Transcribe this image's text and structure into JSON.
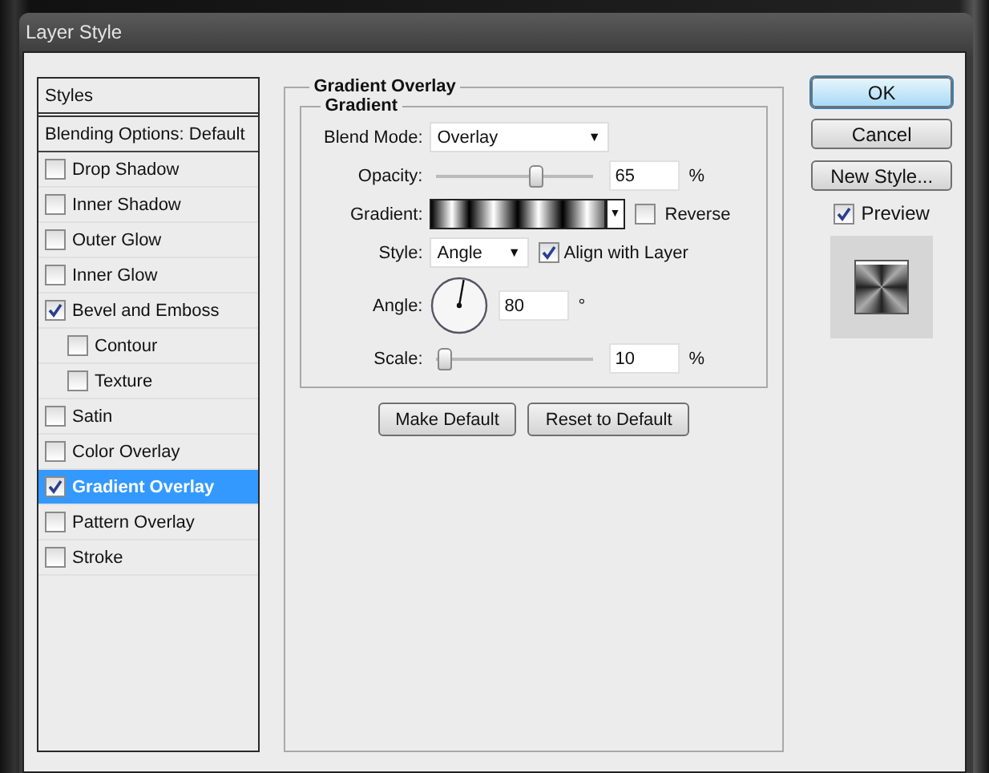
{
  "window": {
    "title": "Layer Style"
  },
  "styles_list": [
    {
      "label": "Styles",
      "kind": "header",
      "selected": false
    },
    {
      "label": "Blending Options: Default",
      "kind": "option",
      "selected": false
    },
    {
      "label": "Drop Shadow",
      "kind": "effect",
      "checked": false,
      "selected": false
    },
    {
      "label": "Inner Shadow",
      "kind": "effect",
      "checked": false,
      "selected": false
    },
    {
      "label": "Outer Glow",
      "kind": "effect",
      "checked": false,
      "selected": false
    },
    {
      "label": "Inner Glow",
      "kind": "effect",
      "checked": false,
      "selected": false
    },
    {
      "label": "Bevel and Emboss",
      "kind": "effect",
      "checked": true,
      "selected": false,
      "children": [
        {
          "label": "Contour",
          "kind": "effect",
          "checked": false,
          "selected": false
        },
        {
          "label": "Texture",
          "kind": "effect",
          "checked": false,
          "selected": false
        }
      ]
    },
    {
      "label": "Satin",
      "kind": "effect",
      "checked": false,
      "selected": false
    },
    {
      "label": "Color Overlay",
      "kind": "effect",
      "checked": false,
      "selected": false
    },
    {
      "label": "Gradient Overlay",
      "kind": "effect",
      "checked": true,
      "selected": true
    },
    {
      "label": "Pattern Overlay",
      "kind": "effect",
      "checked": false,
      "selected": false
    },
    {
      "label": "Stroke",
      "kind": "effect",
      "checked": false,
      "selected": false
    }
  ],
  "panel": {
    "title": "Gradient Overlay",
    "group_title": "Gradient",
    "blend_mode": {
      "label": "Blend Mode:",
      "value": "Overlay",
      "arrow": "▼"
    },
    "opacity": {
      "label": "Opacity:",
      "level": 0.65,
      "value": "65",
      "unit": "%"
    },
    "gradient": {
      "label": "Gradient:",
      "arrow": "▼",
      "reverse": {
        "label": "Reverse",
        "checked": false
      }
    },
    "style": {
      "label": "Style:",
      "value": "Angle",
      "arrow": "▼",
      "align": {
        "label": "Align with Layer",
        "checked": true
      }
    },
    "angle": {
      "label": "Angle:",
      "value": "80",
      "unit": "°"
    },
    "scale": {
      "label": "Scale:",
      "level": 0,
      "value": "10",
      "unit": "%"
    },
    "buttons": [
      "Make Default",
      "Reset to Default"
    ]
  },
  "side_buttons": [
    {
      "label": "OK",
      "primary": true
    },
    {
      "label": "Cancel",
      "primary": false
    },
    {
      "label": "New Style...",
      "primary": false
    }
  ],
  "preview": {
    "label": "Preview",
    "checked": true
  }
}
